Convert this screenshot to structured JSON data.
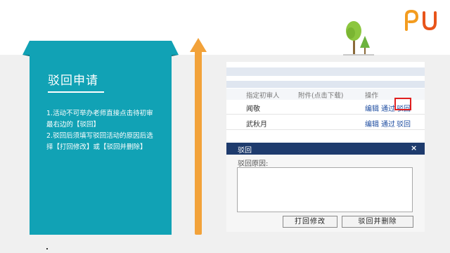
{
  "card": {
    "title": "驳回申请",
    "lines": [
      "1.活动不可举办老师直接点击待初审",
      "最右边的【驳回】",
      "2.驳回后须填写驳回活动的原因后选",
      "择【打回修改】或【驳回并删除】"
    ]
  },
  "table": {
    "headers": [
      "指定初审人",
      "附件(点击下载)",
      "操作"
    ],
    "rows": [
      {
        "name": "闻敬",
        "actions": [
          "编辑",
          "通过",
          "驳回"
        ]
      },
      {
        "name": "武秋月",
        "actions": [
          "编辑",
          "通过",
          "驳回"
        ]
      }
    ]
  },
  "dialog": {
    "title": "驳回",
    "close": "×",
    "reason_label": "驳回原因:",
    "buttons": [
      "打回修改",
      "驳回并删除"
    ]
  },
  "colors": {
    "card": "#11a2b5",
    "arrow": "#f2a23a",
    "dialog_title": "#1e3b6d",
    "highlight": "#e02020",
    "link": "#1f4ea1"
  },
  "icons": [
    "logo-icon",
    "tree-icon",
    "arrow-icon"
  ]
}
